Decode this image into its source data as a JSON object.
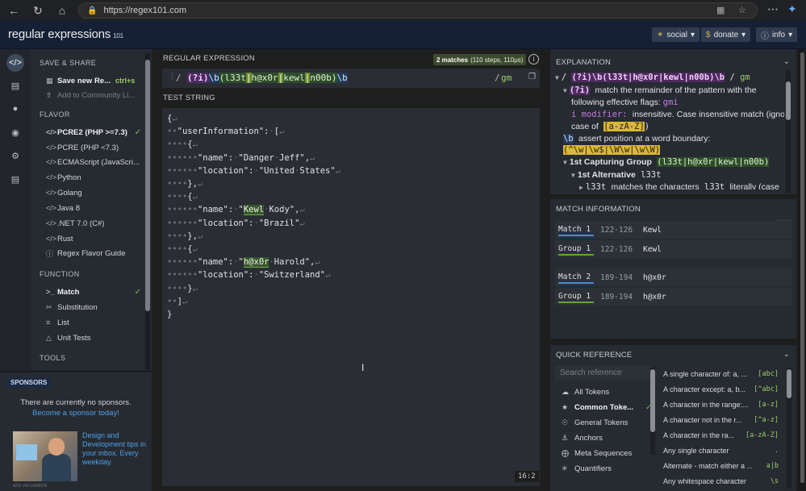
{
  "browser": {
    "url": "https://regex101.com"
  },
  "header": {
    "logo": "regular expressions",
    "logo_version": "101",
    "social_label": "social",
    "donate_label": "donate",
    "info_label": "info"
  },
  "sidebar": {
    "save_share_title": "SAVE & SHARE",
    "save_new_label": "Save new Re...",
    "save_new_shortcut": "ctrl+s",
    "add_community_label": "Add to Community Li...",
    "flavor_title": "FLAVOR",
    "flavors": [
      {
        "label": "PCRE2 (PHP >=7.3)",
        "selected": true
      },
      {
        "label": "PCRE (PHP <7.3)"
      },
      {
        "label": "ECMAScript (JavaScri..."
      },
      {
        "label": "Python"
      },
      {
        "label": "Golang"
      },
      {
        "label": "Java 8"
      },
      {
        "label": ".NET 7.0 (C#)"
      },
      {
        "label": "Rust"
      },
      {
        "label": "Regex Flavor Guide"
      }
    ],
    "function_title": "FUNCTION",
    "functions": [
      {
        "label": "Match",
        "selected": true
      },
      {
        "label": "Substitution"
      },
      {
        "label": "List"
      },
      {
        "label": "Unit Tests"
      }
    ],
    "tools_title": "TOOLS"
  },
  "sponsors": {
    "tag": "SPONSORS",
    "no_sponsors_text": "There are currently no sponsors.",
    "become_sponsor_link": "Become a sponsor today!",
    "ad_text": "Design and Development tips in your inbox. Every weekday.",
    "ad_credit": "ADS VIA CARBON"
  },
  "regex": {
    "section_title": "REGULAR EXPRESSION",
    "match_count": "2 matches",
    "match_stats": "(110 steps, 110μs)",
    "open_delim": "/",
    "pattern": "(?i)\\b(l33t|h@x0r|kewl|n00b)\\b",
    "close_delim": "/",
    "flags": "gm"
  },
  "test_string": {
    "section_title": "TEST STRING",
    "lines": [
      "{",
      "  \"userInformation\": [",
      "    {",
      "      \"name\": \"Danger Jeff\",",
      "      \"location\": \"United States\"",
      "    },",
      "    {",
      "      \"name\": \"Kewl Kody\",",
      "      \"location\": \"Brazil\"",
      "    },",
      "    {",
      "      \"name\": \"h@x0r Harold\",",
      "      \"location\": \"Switzerland\"",
      "    }",
      "  ]",
      "}"
    ],
    "cursor_position": "16:2"
  },
  "explanation": {
    "section_title": "EXPLANATION",
    "line1_pattern": "(?i)\\b(l33t|h@x0r|kewl|n00b)\\b",
    "line1_flags": "gm",
    "line2_mod": "(?i)",
    "line2_text": "match the remainder of the pattern with the",
    "line3_text": "following effective flags:",
    "line3_flags": "gmi",
    "line4_flag": "i modifier:",
    "line4_text": "insensitive. Case insensitive match (ignores",
    "line5_prefix": "case of",
    "line5_range": "[a-zA-Z]",
    "line5_suffix": ")",
    "line6_token": "\\b",
    "line6_text": "assert position at a word boundary:",
    "line7_assertion": "(^\\w|\\w$|\\W\\w|\\w\\W)",
    "line8_title": "1st Capturing Group",
    "line8_group": "(l33t|h@x0r|kewl|n00b)",
    "line9_title": "1st Alternative",
    "line9_token": "l33t",
    "line10_token": "l33t",
    "line10_text": "matches the characters",
    "line10_token2": "l33t",
    "line10_text2": "literally (case"
  },
  "match_info": {
    "section_title": "MATCH INFORMATION",
    "rows": [
      {
        "label": "Match 1",
        "range": "122-126",
        "value": "Kewl"
      },
      {
        "label": "Group 1",
        "range": "122-126",
        "value": "Kewl"
      },
      {
        "label": "Match 2",
        "range": "189-194",
        "value": "h@x0r"
      },
      {
        "label": "Group 1",
        "range": "189-194",
        "value": "h@x0r"
      }
    ]
  },
  "quick_reference": {
    "section_title": "QUICK REFERENCE",
    "search_placeholder": "Search reference",
    "categories": [
      {
        "label": "All Tokens",
        "icon": "cloud-icon"
      },
      {
        "label": "Common Toke...",
        "icon": "star-icon",
        "selected": true
      },
      {
        "label": "General Tokens",
        "icon": "circle-dot-icon"
      },
      {
        "label": "Anchors",
        "icon": "anchor-icon"
      },
      {
        "label": "Meta Sequences",
        "icon": "x-circle-icon"
      },
      {
        "label": "Quantifiers",
        "icon": "asterisk-circle-icon"
      }
    ],
    "tokens": [
      {
        "desc": "A single character of: a, ...",
        "code": "[abc]"
      },
      {
        "desc": "A character except: a, b...",
        "code": "[^abc]"
      },
      {
        "desc": "A character in the range:...",
        "code": "[a-z]"
      },
      {
        "desc": "A character not in the r...",
        "code": "[^a-z]"
      },
      {
        "desc": "A character in the ra...",
        "code": "[a-zA-Z]"
      },
      {
        "desc": "Any single character",
        "code": "."
      },
      {
        "desc": "Alternate - match either a ...",
        "code": "a|b"
      },
      {
        "desc": "Any whitespace character",
        "code": "\\s"
      }
    ]
  }
}
